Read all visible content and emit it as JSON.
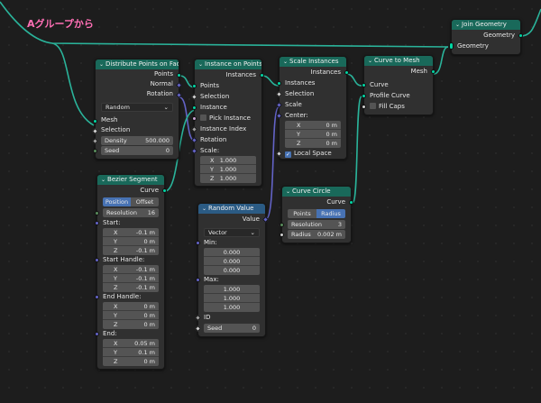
{
  "frame": {
    "label": "Aグループから"
  },
  "join": {
    "title": "Join Geometry",
    "out": "Geometry",
    "in": "Geometry"
  },
  "dist": {
    "title": "Distribute Points on Faces",
    "outs": [
      "Points",
      "Normal",
      "Rotation"
    ],
    "mode": "Random",
    "mesh": "Mesh",
    "selection": "Selection",
    "density_label": "Density",
    "density": "500.000",
    "seed_label": "Seed",
    "seed": "0"
  },
  "iop": {
    "title": "Instance on Points",
    "out": "Instances",
    "points": "Points",
    "selection": "Selection",
    "instance": "Instance",
    "pick": "Pick Instance",
    "index": "Instance Index",
    "rotation": "Rotation",
    "scale": "Scale:",
    "axes": [
      "X",
      "Y",
      "Z"
    ],
    "vals": [
      "1.000",
      "1.000",
      "1.000"
    ]
  },
  "scale": {
    "title": "Scale Instances",
    "out": "Instances",
    "instances": "Instances",
    "selection": "Selection",
    "scale": "Scale",
    "center": "Center:",
    "axes": [
      "X",
      "Y",
      "Z"
    ],
    "vals": [
      "0 m",
      "0 m",
      "0 m"
    ],
    "local": "Local Space"
  },
  "c2m": {
    "title": "Curve to Mesh",
    "out": "Mesh",
    "curve": "Curve",
    "profile": "Profile Curve",
    "fill": "Fill Caps"
  },
  "bezier": {
    "title": "Bezier Segment",
    "out": "Curve",
    "mode_a": "Position",
    "mode_b": "Offset",
    "res_label": "Resolution",
    "res": "16",
    "start": "Start:",
    "start_vals": [
      "-0.1 m",
      "0 m",
      "-0.1 m"
    ],
    "sh": "Start Handle:",
    "sh_vals": [
      "-0.1 m",
      "-0.1 m",
      "-0.1 m"
    ],
    "eh": "End Handle:",
    "eh_vals": [
      "0 m",
      "0 m",
      "0 m"
    ],
    "end": "End:",
    "end_vals": [
      "0.05 m",
      "0.1 m",
      "0 m"
    ],
    "axes": [
      "X",
      "Y",
      "Z"
    ]
  },
  "rv": {
    "title": "Random Value",
    "out": "Value",
    "type": "Vector",
    "min": "Min:",
    "min_vals": [
      "0.000",
      "0.000",
      "0.000"
    ],
    "max": "Max:",
    "max_vals": [
      "1.000",
      "1.000",
      "1.000"
    ],
    "id": "ID",
    "seed_label": "Seed",
    "seed": "0"
  },
  "circle": {
    "title": "Curve Circle",
    "out": "Curve",
    "mode_a": "Points",
    "mode_b": "Radius",
    "res_label": "Resolution",
    "res": "3",
    "rad_label": "Radius",
    "rad": "0.002 m"
  },
  "colors": {
    "geometry": "#00d6a3",
    "vector": "#6363c7",
    "header_geo": "#19695a",
    "header_input": "#2b5b84",
    "frame_label": "#ff6fb5"
  }
}
